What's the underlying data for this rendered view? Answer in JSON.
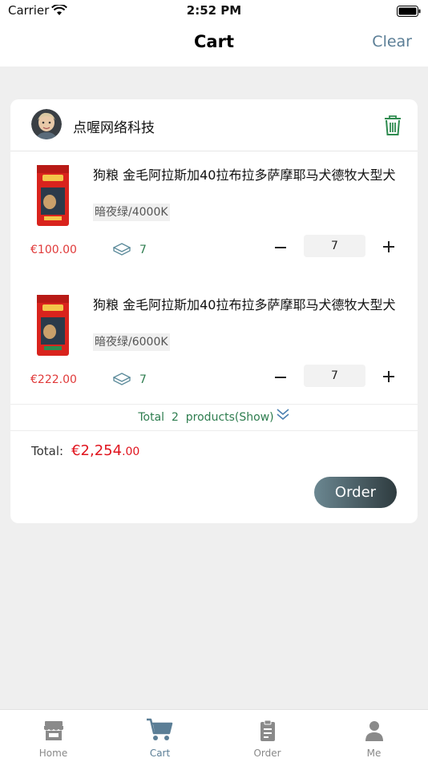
{
  "status_bar": {
    "carrier": "Carrier",
    "time": "2:52 PM"
  },
  "nav": {
    "title": "Cart",
    "clear_label": "Clear"
  },
  "shop": {
    "name": "点喔网络科技"
  },
  "items": [
    {
      "title": "狗粮 金毛阿拉斯加40拉布拉多萨摩耶马犬德牧大型犬",
      "spec": "暗夜绿/4000K",
      "price": "€100.00",
      "stock": "7",
      "quantity": "7"
    },
    {
      "title": "狗粮 金毛阿拉斯加40拉布拉多萨摩耶马犬德牧大型犬",
      "spec": "暗夜绿/6000K",
      "price": "€222.00",
      "stock": "7",
      "quantity": "7"
    }
  ],
  "summary": {
    "total_products_text": "Total  2  products(Show)",
    "total_label": "Total:",
    "total_integer": "€2,254",
    "total_decimal": ".00",
    "order_label": "Order"
  },
  "tabs": [
    {
      "label": "Home",
      "icon": "store-icon",
      "active": false
    },
    {
      "label": "Cart",
      "icon": "cart-icon",
      "active": true
    },
    {
      "label": "Order",
      "icon": "clipboard-icon",
      "active": false
    },
    {
      "label": "Me",
      "icon": "person-icon",
      "active": false
    }
  ],
  "colors": {
    "accent": "#5b7e96",
    "price": "#e0141e",
    "green": "#2e7d4f"
  }
}
